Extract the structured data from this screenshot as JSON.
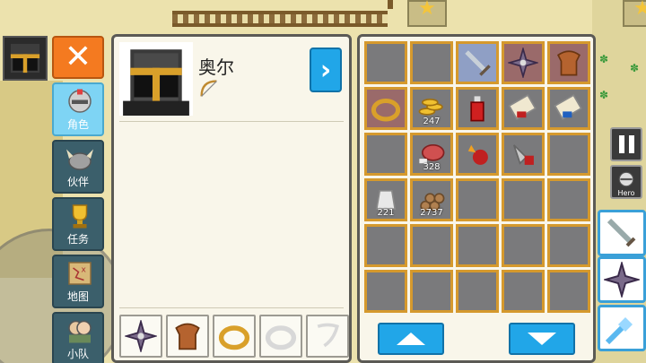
{
  "character": {
    "name": "奥尔"
  },
  "tabs": [
    {
      "label": "角色",
      "icon": "knight-helmet-icon",
      "active": true
    },
    {
      "label": "伙伴",
      "icon": "viking-helmet-icon",
      "active": false
    },
    {
      "label": "任务",
      "icon": "trophy-icon",
      "active": false
    },
    {
      "label": "地图",
      "icon": "map-scroll-icon",
      "active": false
    },
    {
      "label": "小队",
      "icon": "party-icon",
      "active": false
    }
  ],
  "equipment": [
    {
      "icon": "shuriken-icon",
      "equipped": true
    },
    {
      "icon": "leather-armor-icon",
      "equipped": true
    },
    {
      "icon": "gold-ring-icon",
      "equipped": true
    },
    {
      "icon": "empty-ring-slot-icon",
      "equipped": false
    },
    {
      "icon": "empty-amulet-slot-icon",
      "equipped": false
    }
  ],
  "inventory": [
    {
      "icon": "",
      "count": ""
    },
    {
      "icon": "",
      "count": ""
    },
    {
      "icon": "sword-icon",
      "count": ""
    },
    {
      "icon": "shuriken-icon",
      "count": ""
    },
    {
      "icon": "leather-armor-icon",
      "count": ""
    },
    {
      "icon": "gold-ring-icon",
      "count": ""
    },
    {
      "icon": "gold-coins-icon",
      "count": "247"
    },
    {
      "icon": "red-potion-icon",
      "count": ""
    },
    {
      "icon": "red-scroll-icon",
      "count": ""
    },
    {
      "icon": "blue-scroll-icon",
      "count": ""
    },
    {
      "icon": "",
      "count": ""
    },
    {
      "icon": "meat-icon",
      "count": "328"
    },
    {
      "icon": "fire-bomb-icon",
      "count": ""
    },
    {
      "icon": "drill-rocket-icon",
      "count": ""
    },
    {
      "icon": "",
      "count": ""
    },
    {
      "icon": "iron-ingot-icon",
      "count": "221"
    },
    {
      "icon": "wood-logs-icon",
      "count": "2737"
    },
    {
      "icon": "",
      "count": ""
    },
    {
      "icon": "",
      "count": ""
    },
    {
      "icon": "",
      "count": ""
    },
    {
      "icon": "",
      "count": ""
    },
    {
      "icon": "",
      "count": ""
    },
    {
      "icon": "",
      "count": ""
    },
    {
      "icon": "",
      "count": ""
    },
    {
      "icon": "",
      "count": ""
    },
    {
      "icon": "",
      "count": ""
    },
    {
      "icon": "",
      "count": ""
    },
    {
      "icon": "",
      "count": ""
    },
    {
      "icon": "",
      "count": ""
    },
    {
      "icon": "",
      "count": ""
    }
  ],
  "hud": {
    "hero_button_label": "Hero"
  },
  "colors": {
    "accent_blue": "#21a6e8",
    "close_orange": "#f47a20",
    "slot_border_gold": "#d5992d"
  }
}
